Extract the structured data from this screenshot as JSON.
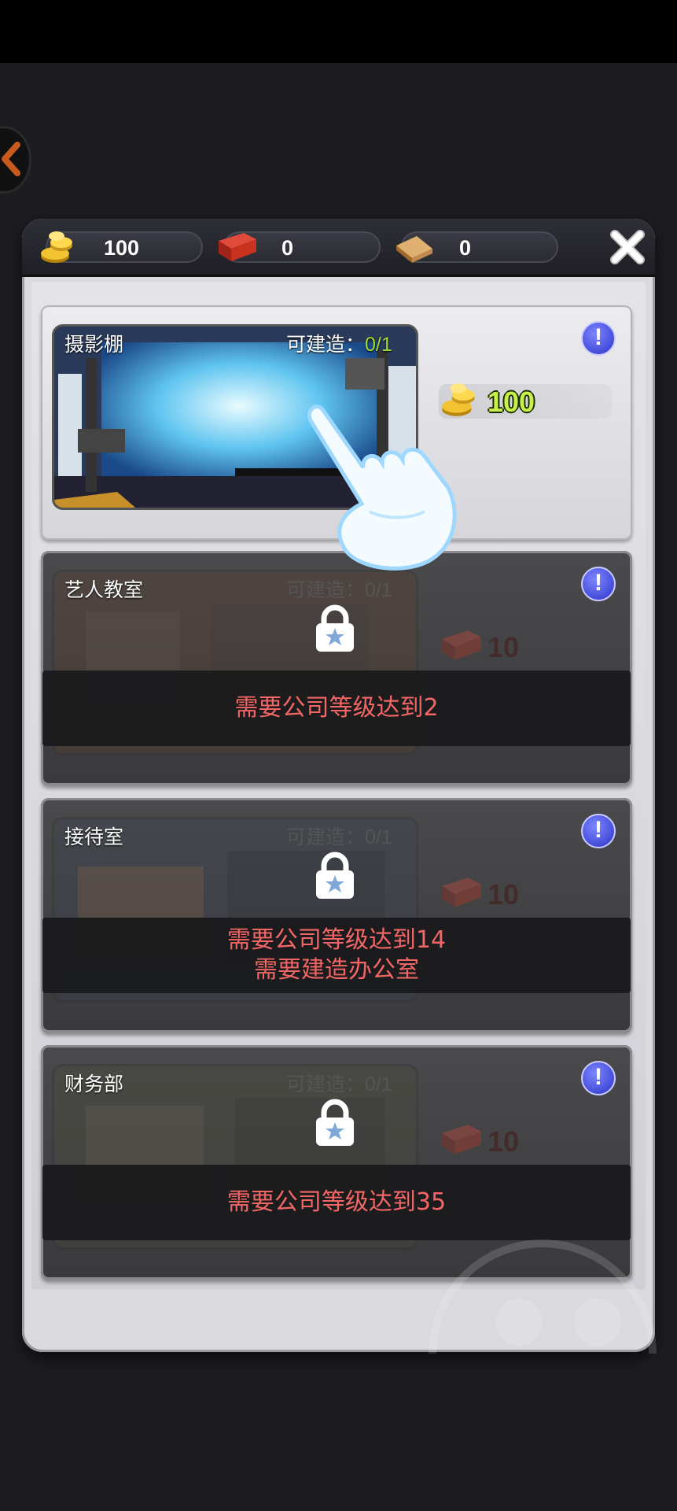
{
  "header": {
    "resources": [
      {
        "name": "coins",
        "icon": "gold-coin-icon",
        "value": "100"
      },
      {
        "name": "bricks",
        "icon": "brick-icon",
        "value": "0"
      },
      {
        "name": "wood",
        "icon": "wood-plank-icon",
        "value": "0"
      }
    ],
    "close_icon": "close-icon"
  },
  "rooms": [
    {
      "name": "摄影棚",
      "build_label": "可建造：",
      "build_count": "0/1",
      "cost_icon": "gold-coin-icon",
      "cost": "100",
      "locked": false
    },
    {
      "name": "艺人教室",
      "build_label": "可建造：",
      "build_count": "0/1",
      "cost_icon": "brick-icon",
      "cost": "10",
      "locked": true,
      "requirements": [
        "需要公司等级达到2"
      ]
    },
    {
      "name": "接待室",
      "build_label": "可建造：",
      "build_count": "0/1",
      "cost_icon": "brick-icon",
      "cost": "10",
      "locked": true,
      "requirements": [
        "需要公司等级达到14",
        "需要建造办公室"
      ]
    },
    {
      "name": "财务部",
      "build_label": "可建造：",
      "build_count": "0/1",
      "cost_icon": "brick-icon",
      "cost": "10",
      "locked": true,
      "requirements": [
        "需要公司等级达到35"
      ]
    }
  ],
  "info_label": "!",
  "colors": {
    "accent_green": "#9fdc3a",
    "requirement_red": "#f26666",
    "info_blue": "#2b34c9"
  }
}
